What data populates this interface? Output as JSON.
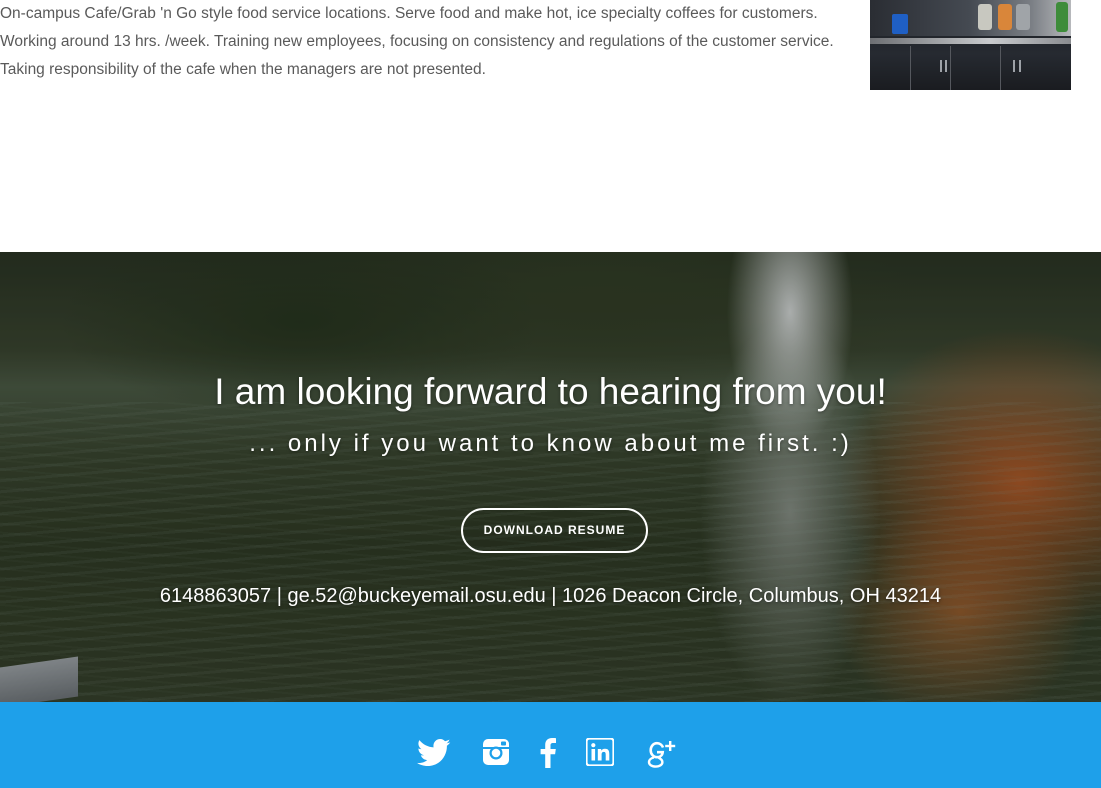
{
  "job": {
    "lines": [
      "On-campus Cafe/Grab 'n Go style food service locations. Serve food and make hot, ice specialty coffees for customers.",
      "Working around 13 hrs. /week. Training new employees, focusing on consistency and regulations of the customer service.",
      "Taking responsibility of the cafe when the managers are not presented."
    ]
  },
  "contact": {
    "heading": "I am looking forward to hearing from you!",
    "subheading": "... only if you want to know about me first. :)",
    "download_label": "DOWNLOAD RESUME",
    "details": "6148863057 | ge.52@buckeyemail.osu.edu | 1026 Deacon Circle, Columbus, OH 43214"
  },
  "footer": {
    "background": "#1ea0ea",
    "social_icons": [
      "twitter-icon",
      "instagram-icon",
      "facebook-icon",
      "linkedin-icon",
      "google-plus-icon"
    ]
  }
}
